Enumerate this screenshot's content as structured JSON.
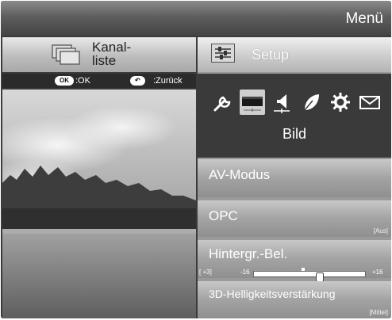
{
  "header": {
    "title": "Menü"
  },
  "left_panel": {
    "title_line1": "Kanal-",
    "title_line2": "liste",
    "hint_ok_key": "OK",
    "hint_ok_text": ":OK",
    "hint_back_key": "↶",
    "hint_back_text": ":Zurück"
  },
  "setup": {
    "title": "Setup",
    "icons": [
      "wrench-icon",
      "picture-icon",
      "audio-icon",
      "eco-leaf-icon",
      "gear-icon",
      "envelope-icon"
    ],
    "selected_icon": "picture-icon",
    "category_label": "Bild"
  },
  "menu_items": [
    {
      "label": "AV-Modus",
      "value": ""
    },
    {
      "label": "OPC",
      "value": "[Aus]"
    },
    {
      "label": "Hintergr.-Bel.",
      "value": ""
    },
    {
      "label": "3D-Helligkeitsverstärkung",
      "value": "[Mittel]"
    }
  ],
  "backlight_slider": {
    "current_text": "[  +3]",
    "min_label": "-16",
    "max_label": "+16",
    "value": 3,
    "min": -16,
    "max": 16
  },
  "colors": {
    "accent": "#ffffff",
    "panel_gray": "#9a9a9a",
    "header_dark": "#444444"
  }
}
